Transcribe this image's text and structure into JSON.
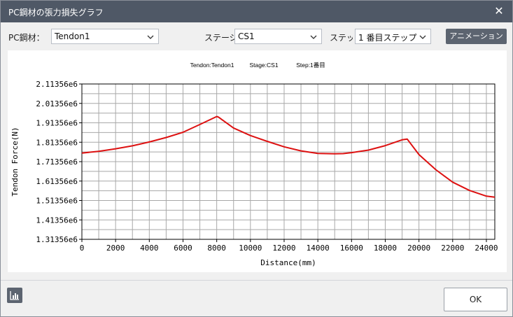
{
  "window": {
    "title": "PC鋼材の張力損失グラフ"
  },
  "controls": {
    "tendon_label": "PC鋼材：",
    "tendon_value": "Tendon1",
    "stage_label": "ステージ",
    "stage_value": "CS1",
    "step_label": "ステップ",
    "step_value": "1 番目ステップ",
    "animation_label": "アニメーション"
  },
  "footer": {
    "ok_label": "OK"
  },
  "icons": {
    "close": "close-icon",
    "dropdown": "chevron-down-icon",
    "chart": "bar-chart-icon"
  },
  "colors": {
    "titlebar": "#4f5866",
    "series": "#dd1111",
    "button_dark": "#5c6470"
  },
  "chart_data": {
    "type": "line",
    "header": {
      "tendon": "Tendon:Tendon1",
      "stage": "Stage:CS1",
      "step": "Step:1番目"
    },
    "xlabel": "Distance(mm)",
    "ylabel": "Tendon Force(N)",
    "xlim": [
      0,
      24500
    ],
    "ylim": [
      1313560,
      2113560
    ],
    "x_ticks": [
      0,
      2000,
      4000,
      6000,
      8000,
      10000,
      12000,
      14000,
      16000,
      18000,
      20000,
      22000,
      24000
    ],
    "x_tick_labels": [
      "0",
      "2000",
      "4000",
      "6000",
      "8000",
      "10000",
      "12000",
      "14000",
      "16000",
      "18000",
      "20000",
      "22000",
      "24000"
    ],
    "y_ticks": [
      1313560,
      1413560,
      1513560,
      1613560,
      1713560,
      1813560,
      1913560,
      2013560,
      2113560
    ],
    "y_tick_labels": [
      "1.31356e6",
      "1.41356e6",
      "1.51356e6",
      "1.61356e6",
      "1.71356e6",
      "1.81356e6",
      "1.91356e6",
      "2.01356e6",
      "2.11356e6"
    ],
    "grid": true,
    "series": [
      {
        "x": [
          0,
          1000,
          2000,
          3000,
          4000,
          5000,
          6000,
          7000,
          8000,
          8100,
          9000,
          10000,
          11000,
          12000,
          13000,
          14000,
          15000,
          15500,
          16000,
          17000,
          18000,
          19000,
          19300,
          20000,
          21000,
          22000,
          23000,
          24000,
          24500
        ],
        "y": [
          1758000,
          1767000,
          1780000,
          1795000,
          1815000,
          1838000,
          1865000,
          1905000,
          1946000,
          1943000,
          1887000,
          1848000,
          1818000,
          1790000,
          1769000,
          1756000,
          1754000,
          1755000,
          1760000,
          1773000,
          1796000,
          1826000,
          1830000,
          1750000,
          1672000,
          1608000,
          1565000,
          1536000,
          1531000
        ]
      }
    ]
  }
}
